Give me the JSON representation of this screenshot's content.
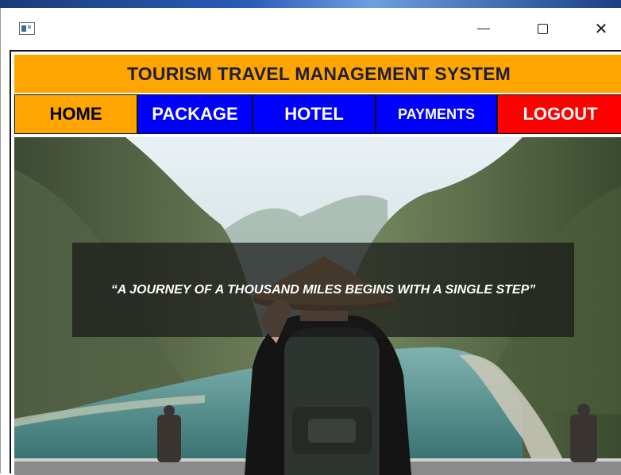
{
  "window": {
    "controls": {
      "minimize_icon": "minimize-icon",
      "maximize_icon": "maximize-icon",
      "close_icon": "close-icon",
      "close_glyph": "✕"
    }
  },
  "header": {
    "title": "TOURISM TRAVEL MANAGEMENT SYSTEM",
    "background": "#ffa500"
  },
  "nav": {
    "home": "HOME",
    "package": "PACKAGE",
    "hotel": "HOTEL",
    "payments": "PAYMENTS",
    "logout": "LOGOUT",
    "colors": {
      "home": "#ffa500",
      "package": "#0000ff",
      "hotel": "#0000ff",
      "payments": "#0000ff",
      "logout": "#ff0000"
    }
  },
  "hero": {
    "quote": "“A JOURNEY OF A THOUSAND MILES BEGINS WITH A SINGLE STEP”"
  }
}
